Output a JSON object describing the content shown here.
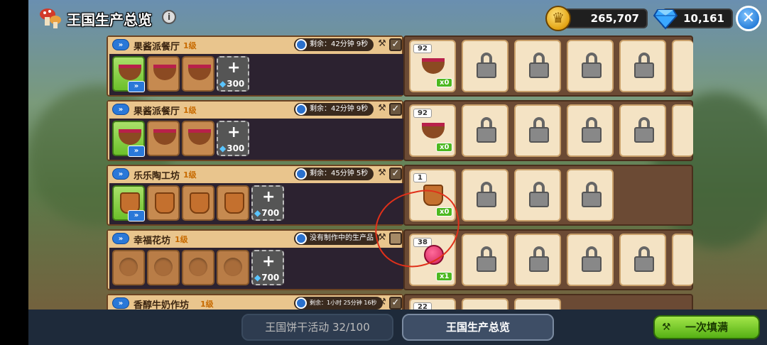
{
  "header": {
    "title": "王国生产总览",
    "info_icon": "i",
    "coins": "265,707",
    "gems": "10,161",
    "close": "✕"
  },
  "rows": [
    {
      "name": "果酱派餐厅",
      "level": "1级",
      "status": "剩余：42分钟 9秒",
      "checked": true,
      "add_cost": "300",
      "output_count": "92",
      "output_qty": "x0"
    },
    {
      "name": "果酱派餐厅",
      "level": "1级",
      "status": "剩余：42分钟 9秒",
      "checked": true,
      "add_cost": "300",
      "output_count": "92",
      "output_qty": "x0"
    },
    {
      "name": "乐乐陶工坊",
      "level": "1级",
      "status": "剩余：45分钟 5秒",
      "checked": true,
      "add_cost": "700",
      "output_count": "1",
      "output_qty": "x0"
    },
    {
      "name": "幸福花坊",
      "level": "1级",
      "status": "没有制作中的生产品",
      "checked": false,
      "add_cost": "700",
      "output_count": "38",
      "output_qty": "x1"
    },
    {
      "name": "香醇牛奶作坊",
      "level": "1级",
      "status": "剩余：1小时 25分钟 16秒",
      "checked": true,
      "output_count": "22"
    }
  ],
  "bottom": {
    "tab_event": "王国饼干活动 32/100",
    "tab_overview": "王国生产总览",
    "fill_button": "一次填满"
  },
  "icons": {
    "speedup": "»",
    "plus": "+",
    "check": "✓",
    "hammer": "⚒"
  }
}
